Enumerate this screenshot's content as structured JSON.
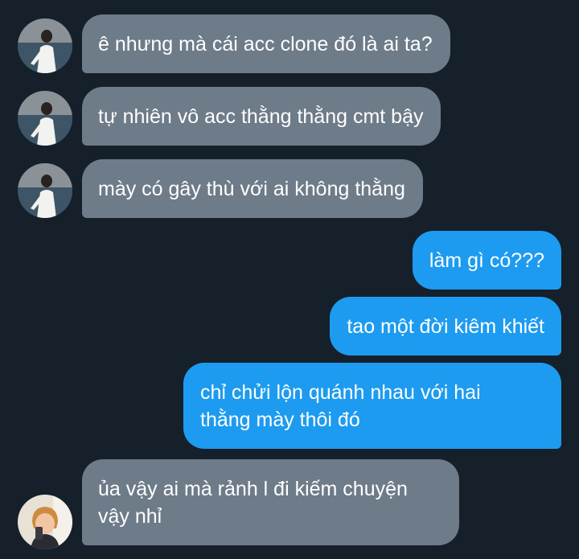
{
  "conversation": {
    "messages": [
      {
        "sender": "them",
        "lines": [
          "ê nhưng mà cái acc clone đó là ai ta?"
        ]
      },
      {
        "sender": "them",
        "lines": [
          "tự nhiên vô acc thằng thằng cmt bậy"
        ]
      },
      {
        "sender": "them",
        "lines": [
          "mày có gây thù với ai không thằng"
        ]
      },
      {
        "sender": "me",
        "lines": [
          "làm gì có???"
        ]
      },
      {
        "sender": "me",
        "lines": [
          "tao một đời kiêm khiết"
        ]
      },
      {
        "sender": "me",
        "lines": [
          "chỉ chửi lộn quánh nhau với hai",
          "thằng mày thôi đó"
        ]
      },
      {
        "sender": "them",
        "lines": [
          "ủa vậy ai mà rảnh l đi kiếm chuyện",
          "vậy nhỉ"
        ]
      }
    ]
  },
  "colors": {
    "background": "#15202b",
    "incoming_bubble": "#6e7b89",
    "outgoing_bubble": "#1d9bf0",
    "text": "#ffffff"
  }
}
